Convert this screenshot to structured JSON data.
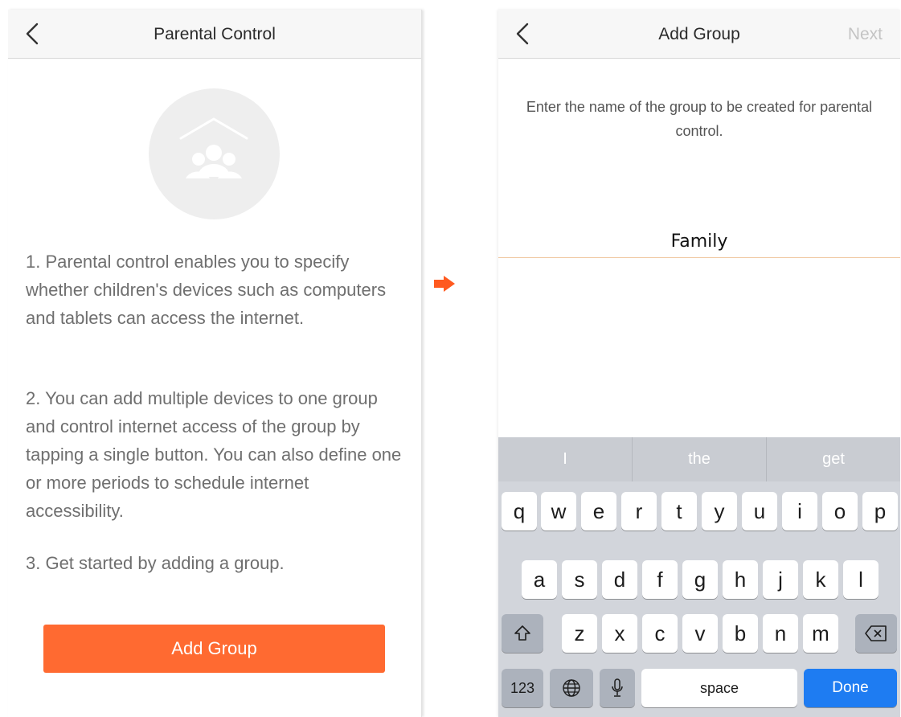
{
  "left": {
    "nav_title": "Parental Control",
    "paragraphs": [
      "1. Parental control enables you to specify whether children's devices such as computers and tablets can access the internet.",
      "2. You can add multiple devices to one group and control internet access of the group by tapping a single button. You can also define one or more periods to schedule internet accessibility.",
      "3. Get started by adding a group."
    ],
    "button_label": "Add Group",
    "accent_color": "#ff6a31",
    "hero_icon": "group-house-icon"
  },
  "right": {
    "nav_title": "Add Group",
    "next_label": "Next",
    "prompt": "Enter the name of the group to be created for parental control.",
    "input_value": "Family",
    "suggestions": [
      "I",
      "the",
      "get"
    ],
    "keyboard": {
      "row1": [
        "q",
        "w",
        "e",
        "r",
        "t",
        "y",
        "u",
        "i",
        "o",
        "p"
      ],
      "row2": [
        "a",
        "s",
        "d",
        "f",
        "g",
        "h",
        "j",
        "k",
        "l"
      ],
      "row3": [
        "z",
        "x",
        "c",
        "v",
        "b",
        "n",
        "m"
      ],
      "numbers_label": "123",
      "space_label": "space",
      "done_label": "Done",
      "done_color": "#1e7cf2"
    }
  },
  "flow_arrow_color": "#ff5a1f"
}
